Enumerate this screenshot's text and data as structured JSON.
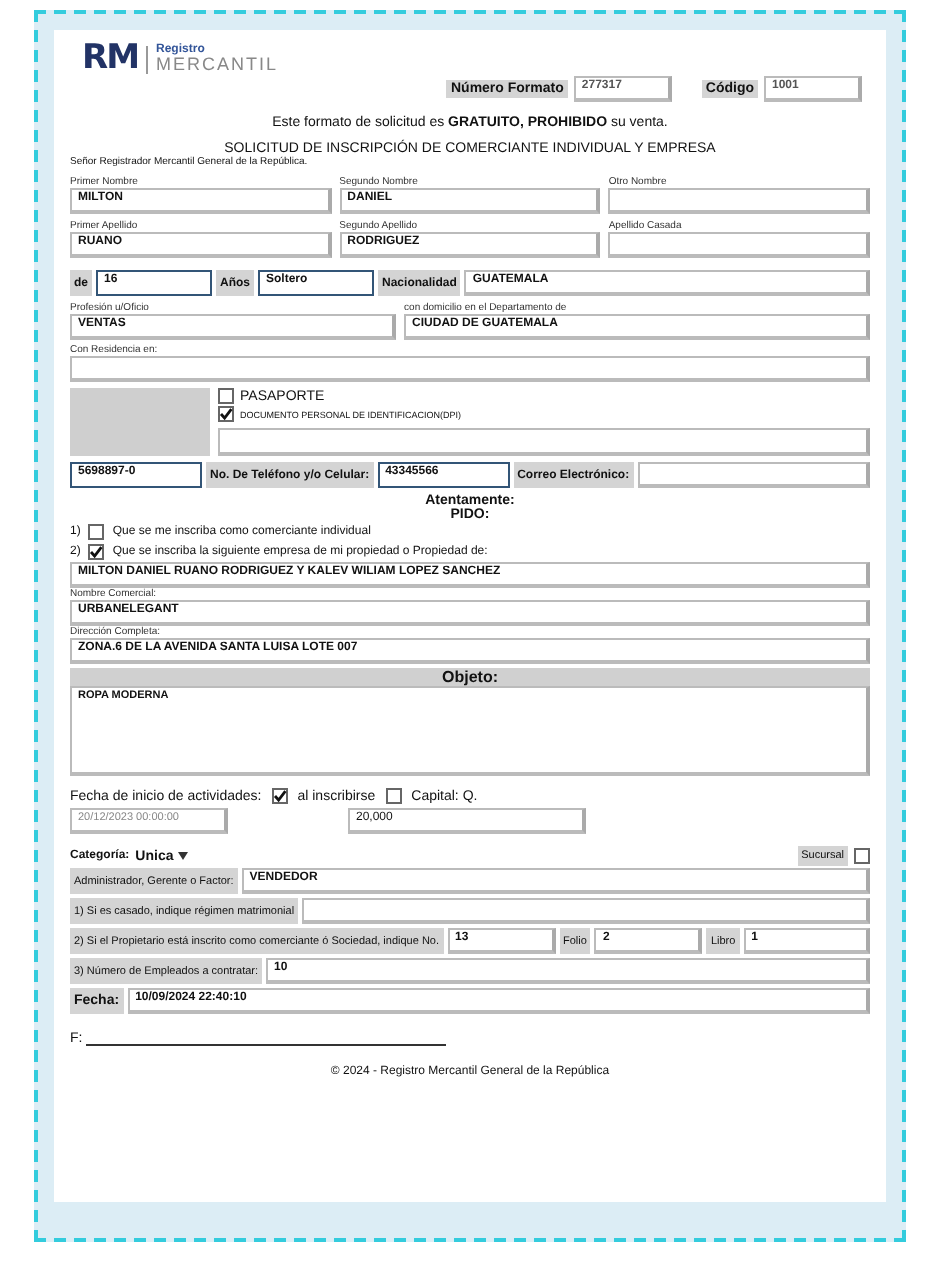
{
  "logo": {
    "initials": "RM",
    "line1": "Registro",
    "line2": "MERCANTIL"
  },
  "header_fields": [
    {
      "label": "Número Formato",
      "value": "277317"
    },
    {
      "label": "Código",
      "value": "1001"
    }
  ],
  "notice": "Este formato de solicitud es **GRATUITO, PROHIBIDO** su venta.",
  "title": "SOLICITUD DE INSCRIPCIÓN DE COMERCIANTE INDIVIDUAL Y EMPRESA",
  "salutation": "Señor Registrador Mercantil General de la República.",
  "names": [
    [
      {
        "label": "Primer Nombre",
        "value": "MILTON"
      },
      {
        "label": "Segundo Nombre",
        "value": "DANIEL"
      },
      {
        "label": "Otro Nombre"
      }
    ],
    [
      {
        "label": "Primer Apellido",
        "value": "RUANO"
      },
      {
        "label": "Segundo Apellido",
        "value": "RODRIGUEZ"
      },
      {
        "label": "Apellido Casada"
      }
    ]
  ],
  "age": {
    "label": "de",
    "value": "16"
  },
  "status": {
    "label": "Años",
    "value": "Soltero"
  },
  "nationality": {
    "label": "Nacionalidad",
    "value": "GUATEMALA"
  },
  "profession": {
    "label": "Profesión u/Oficio",
    "value": "VENTAS"
  },
  "domicile": {
    "label": "con domicilio en el Departamento de",
    "value": "CIUDAD DE GUATEMALA"
  },
  "residence": {
    "label": "Con Residencia en:"
  },
  "documents": [
    {
      "label": "PASAPORTE",
      "checked": false
    },
    {
      "label": "DOCUMENTO PERSONAL DE IDENTIFICACION(DPI)",
      "checked": true
    }
  ],
  "id_number": "5698897-0",
  "phone": {
    "label": "No. De Teléfono y/o Celular:",
    "value": "43345566"
  },
  "email": {
    "label": "Correo Electrónico:"
  },
  "closing": [
    "Atentamente:",
    "PIDO:"
  ],
  "requests": [
    {
      "number": "1)",
      "text": "Que se me inscriba como comerciante individual",
      "checked": false
    },
    {
      "number": "2)",
      "text": "Que se inscriba la siguiente empresa de mi propiedad o Propiedad de:",
      "checked": true
    }
  ],
  "owners": "MILTON DANIEL RUANO RODRIGUEZ Y KALEV WILIAM LOPEZ SANCHEZ",
  "trade_name": {
    "label": "Nombre Comercial:",
    "value": "URBANELEGANT"
  },
  "address": {
    "label": "Dirección Completa:",
    "value": "ZONA.6 DE LA AVENIDA SANTA LUISA LOTE 007"
  },
  "object": {
    "label": "Objeto:",
    "value": "ROPA MODERNA"
  },
  "start": {
    "label": "Fecha de inicio de actividades:",
    "checked": true
  },
  "on_register": {
    "label": "al inscribirse",
    "checked": false
  },
  "capital": {
    "label": "Capital: Q.",
    "value": "20,000"
  },
  "start_date": "20/12/2023 00:00:00",
  "category": {
    "label": "Categoría:",
    "value": "Unica"
  },
  "branch": {
    "label": "Sucursal",
    "checked": false
  },
  "lines": [
    {
      "label": "Administrador, Gerente o Factor:",
      "value": "VENDEDOR"
    },
    {
      "label": "1) Si es casado, indique régimen matrimonial"
    }
  ],
  "registration": {
    "label": "2) Si el Propietario está inscrito como comerciante ó Sociedad, indique No.",
    "value": "13",
    "folio": {
      "label": "Folio",
      "value": "2"
    },
    "book": {
      "label": "Libro",
      "value": "1"
    }
  },
  "employees": {
    "label": "3) Número de Empleados a contratar:",
    "value": "10"
  },
  "date": {
    "label": "Fecha:",
    "value": "10/09/2024 22:40:10"
  },
  "signature_label": "F:",
  "footer": "© 2024 - Registro Mercantil General de la República"
}
